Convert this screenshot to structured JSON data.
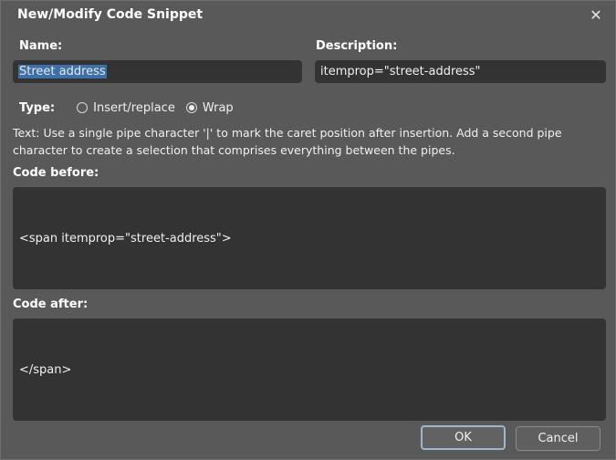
{
  "window": {
    "title": "New/Modify Code Snippet",
    "close_glyph": "✕"
  },
  "form": {
    "name_label": "Name:",
    "name_value": "Street address",
    "description_label": "Description:",
    "description_value": "itemprop=\"street-address\"",
    "type_label": "Type:",
    "type_options": [
      {
        "label": "Insert/replace",
        "checked": false
      },
      {
        "label": "Wrap",
        "checked": true
      }
    ],
    "help_text": "Text: Use a single pipe character '|' to mark the caret position after insertion. Add a second pipe character to create a selection that comprises everything between the pipes.",
    "code_before_label": "Code before:",
    "code_before_value": "<span itemprop=\"street-address\">",
    "code_after_label": "Code after:",
    "code_after_value": "</span>"
  },
  "buttons": {
    "ok": "OK",
    "cancel": "Cancel"
  },
  "colors": {
    "dialog_bg": "#595959",
    "field_bg": "#333333",
    "selection": "#3d6fa8",
    "ok_border": "#9eb6cf"
  },
  "icons": {
    "close": "close-icon"
  }
}
